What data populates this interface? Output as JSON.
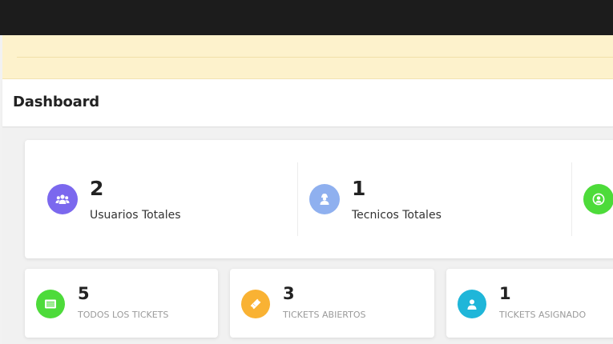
{
  "header": {
    "title": "Dashboard"
  },
  "stats": [
    {
      "value": "2",
      "label": "Usuarios Totales",
      "icon": "users-icon",
      "color": "#7b68ee"
    },
    {
      "value": "1",
      "label": "Tecnicos Totales",
      "icon": "technician-icon",
      "color": "#8fb0ef"
    },
    {
      "value": "",
      "label": "",
      "icon": "user-circle-icon",
      "color": "#4ddb3a"
    }
  ],
  "tickets": [
    {
      "value": "5",
      "label": "TODOS LOS TICKETS",
      "icon": "list-icon",
      "color": "#4ddb3a"
    },
    {
      "value": "3",
      "label": "TICKETS ABIERTOS",
      "icon": "ticket-icon",
      "color": "#f9b233"
    },
    {
      "value": "1",
      "label": "TICKETS ASIGNADO",
      "icon": "user-icon",
      "color": "#1fb6d9"
    }
  ]
}
